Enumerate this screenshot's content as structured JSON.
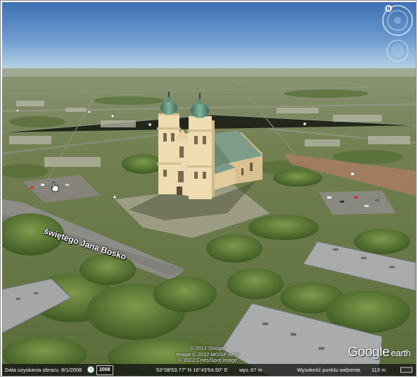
{
  "map": {
    "street_label": "świętego Jana Bosko",
    "credits": [
      "© 2012 Google",
      "Image © 2012 MGGP Aero",
      "© 2012 Cnes/Spot Image"
    ],
    "logo": {
      "google": "Google",
      "earth": "earth"
    }
  },
  "navigation": {
    "north_label": "N",
    "controls": [
      "look-joystick",
      "move-joystick"
    ]
  },
  "statusbar": {
    "imagery_date_label": "Data uzyskania obrazu",
    "imagery_date": "8/1/2008",
    "history_year": "2008",
    "coordinates": "53°08'53.77\" N   16°43'54.50\" E",
    "elevation_label": "wys.",
    "elevation": "67 m",
    "eye_alt_label": "Wysokość punktu widzenia",
    "eye_alt": "113 m"
  },
  "colors": {
    "sky_top": "#3e6fb1",
    "sky_horizon": "#b9d3e6",
    "ground": "#6d7a4c",
    "church_wall": "#e9d4a8",
    "church_dome": "#5f8f79",
    "church_roof": "#7f9c8b",
    "block_roof": "#a5a7a6"
  },
  "icons": {
    "north": "compass-north-icon",
    "look": "look-around-icon",
    "move": "pan-move-icon",
    "history": "historical-imagery-icon",
    "cursor": "hand-cursor-icon"
  }
}
